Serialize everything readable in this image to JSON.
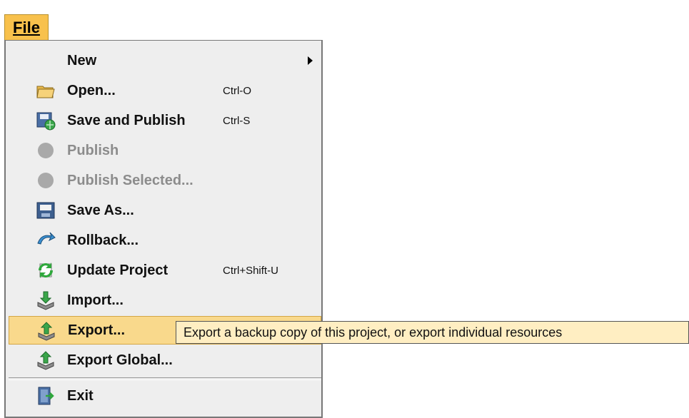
{
  "menubar": {
    "file_label": "File"
  },
  "menu": {
    "items": [
      {
        "label": "New",
        "shortcut": "",
        "icon": "none",
        "disabled": false,
        "submenu": true
      },
      {
        "label": "Open...",
        "shortcut": "Ctrl-O",
        "icon": "folder-open-icon",
        "disabled": false
      },
      {
        "label": "Save and Publish",
        "shortcut": "Ctrl-S",
        "icon": "save-publish-icon",
        "disabled": false
      },
      {
        "label": "Publish",
        "shortcut": "",
        "icon": "disabled-circle-icon",
        "disabled": true
      },
      {
        "label": "Publish Selected...",
        "shortcut": "",
        "icon": "disabled-circle-icon",
        "disabled": true
      },
      {
        "label": "Save As...",
        "shortcut": "",
        "icon": "save-as-icon",
        "disabled": false
      },
      {
        "label": "Rollback...",
        "shortcut": "",
        "icon": "rollback-icon",
        "disabled": false
      },
      {
        "label": "Update Project",
        "shortcut": "Ctrl+Shift-U",
        "icon": "update-icon",
        "disabled": false
      },
      {
        "label": "Import...",
        "shortcut": "",
        "icon": "import-icon",
        "disabled": false
      },
      {
        "label": "Export...",
        "shortcut": "",
        "icon": "export-icon",
        "disabled": false,
        "highlighted": true
      },
      {
        "label": "Export Global...",
        "shortcut": "",
        "icon": "export-icon",
        "disabled": false
      },
      {
        "label": "Exit",
        "shortcut": "",
        "icon": "exit-icon",
        "disabled": false
      }
    ]
  },
  "tooltip": {
    "text": "Export a backup copy of this project, or export individual resources"
  },
  "colors": {
    "highlight": "#f9d98c",
    "menubar_active": "#f8c14c",
    "tooltip_bg": "#ffeec2",
    "disabled_text": "#8c8c8c"
  }
}
